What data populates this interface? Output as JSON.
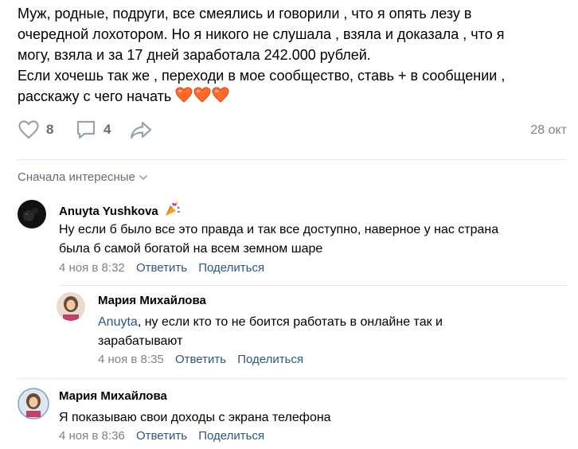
{
  "post": {
    "lines": [
      "Муж, родные, подруги, все смеялись и говорили , что я опять лезу в",
      "очередной лохотором. Но я никого не слушала , взяла и доказала , что я",
      "могу, взяла и за 17 дней заработала 242.000 рублей.",
      "Если хочешь так же , переходи в мое сообщество, ставь + в сообщении ,"
    ],
    "last_line": "расскажу с чего начать",
    "likes": "8",
    "comments": "4",
    "date": "28 окт"
  },
  "sort_label": "Сначала интересные",
  "comments": [
    {
      "author": "Anuyta Yushkova",
      "text_lines": [
        "Ну если б было все это правда и так все доступно, наверное у нас страна",
        "была б самой богатой на всем земном шаре"
      ],
      "date": "4 ноя в 8:32",
      "reply_label": "Ответить",
      "share_label": "Поделиться"
    },
    {
      "author": "Мария Михайлова",
      "mention": "Anuyta",
      "text_after_mention": ", ну если кто то не боится работать в онлайне так и",
      "text_line2": "зарабатывают",
      "date": "4 ноя в 8:35",
      "reply_label": "Ответить",
      "share_label": "Поделиться"
    },
    {
      "author": "Мария Михайлова",
      "text": "Я показываю свои доходы с экрана телефона",
      "date": "4 ноя в 8:36",
      "reply_label": "Ответить",
      "share_label": "Поделиться"
    }
  ],
  "icons": {
    "like": "heart-outline-icon",
    "comment": "comment-icon",
    "share": "share-arrow-icon",
    "emoji": "orange-heart-emoji",
    "badge": "party-popper-icon"
  },
  "colors": {
    "link": "#2a5885",
    "secondary": "#828282",
    "icon": "#99a2ad",
    "heart": "#ff6a2a"
  }
}
